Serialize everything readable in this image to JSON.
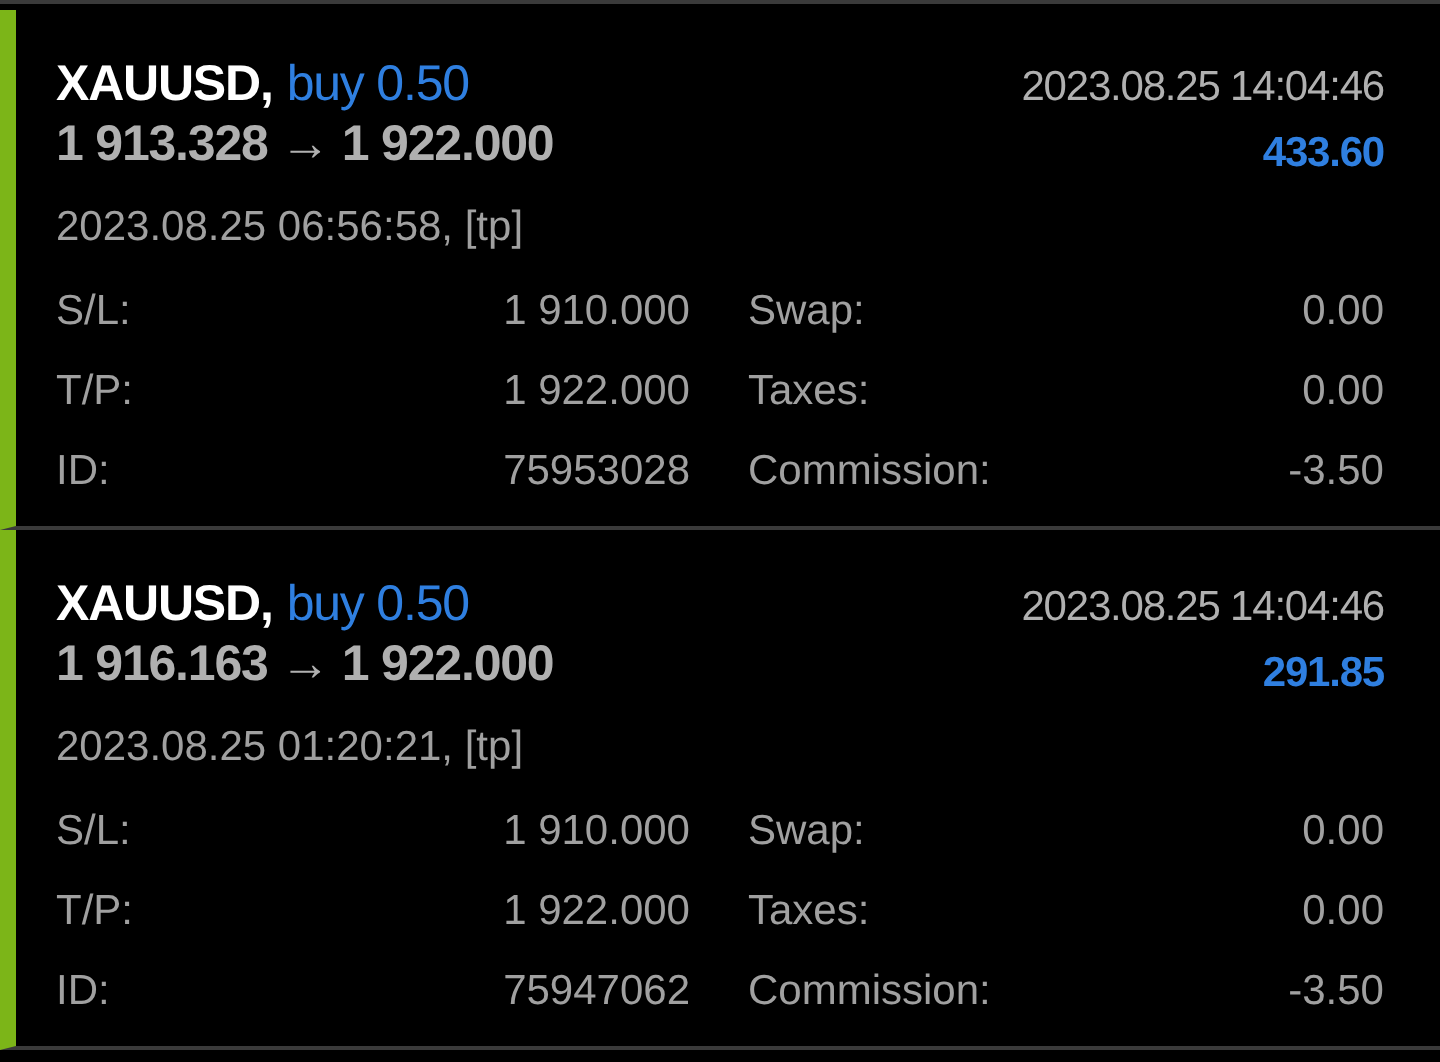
{
  "trades": [
    {
      "symbol": "XAUUSD,",
      "action": "buy 0.50",
      "close_time": "2023.08.25 14:04:46",
      "prices": "1 913.328 → 1 922.000",
      "profit": "433.60",
      "open_info": "2023.08.25 06:56:58, [tp]",
      "details": [
        {
          "label": "S/L:",
          "value": "1 910.000"
        },
        {
          "label": "Swap:",
          "value": "0.00"
        },
        {
          "label": "T/P:",
          "value": "1 922.000"
        },
        {
          "label": "Taxes:",
          "value": "0.00"
        },
        {
          "label": "ID:",
          "value": "75953028"
        },
        {
          "label": "Commission:",
          "value": "-3.50"
        }
      ]
    },
    {
      "symbol": "XAUUSD,",
      "action": "buy 0.50",
      "close_time": "2023.08.25 14:04:46",
      "prices": "1 916.163 → 1 922.000",
      "profit": "291.85",
      "open_info": "2023.08.25 01:20:21, [tp]",
      "details": [
        {
          "label": "S/L:",
          "value": "1 910.000"
        },
        {
          "label": "Swap:",
          "value": "0.00"
        },
        {
          "label": "T/P:",
          "value": "1 922.000"
        },
        {
          "label": "Taxes:",
          "value": "0.00"
        },
        {
          "label": "ID:",
          "value": "75947062"
        },
        {
          "label": "Commission:",
          "value": "-3.50"
        }
      ]
    }
  ]
}
